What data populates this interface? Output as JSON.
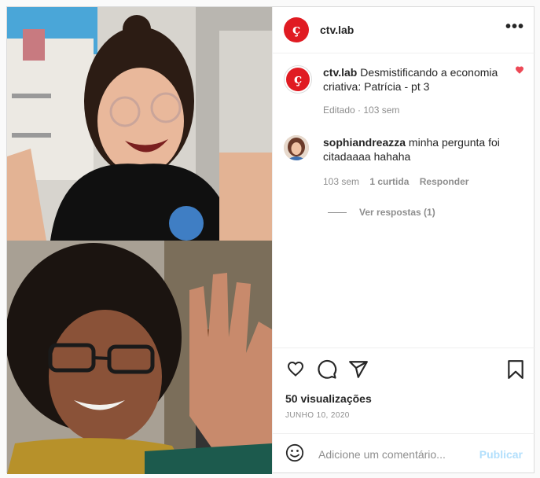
{
  "account": {
    "username": "ctv.lab",
    "logo_glyph": "ç"
  },
  "header": {
    "more_label": "•••"
  },
  "caption": {
    "username": "ctv.lab",
    "text": "Desmistificando a economia criativa: Patrícia - pt 3",
    "meta": "Editado · 103 sem"
  },
  "comment": {
    "username": "sophiandreazza",
    "text": "minha pergunta foi citadaaaa hahaha",
    "time": "103 sem",
    "likes": "1 curtida",
    "reply": "Responder",
    "view_replies": "Ver respostas (1)",
    "liked": true
  },
  "actions": {
    "icons": [
      "heart-icon",
      "comment-icon",
      "share-icon",
      "bookmark-icon"
    ]
  },
  "views": "50 visualizações",
  "date": "JUNHO 10, 2020",
  "add_comment": {
    "placeholder": "Adicione um comentário...",
    "publish": "Publicar"
  },
  "colors": {
    "brand": "#e01b22",
    "like": "#ed4956",
    "publish_disabled": "#b2dffc"
  }
}
